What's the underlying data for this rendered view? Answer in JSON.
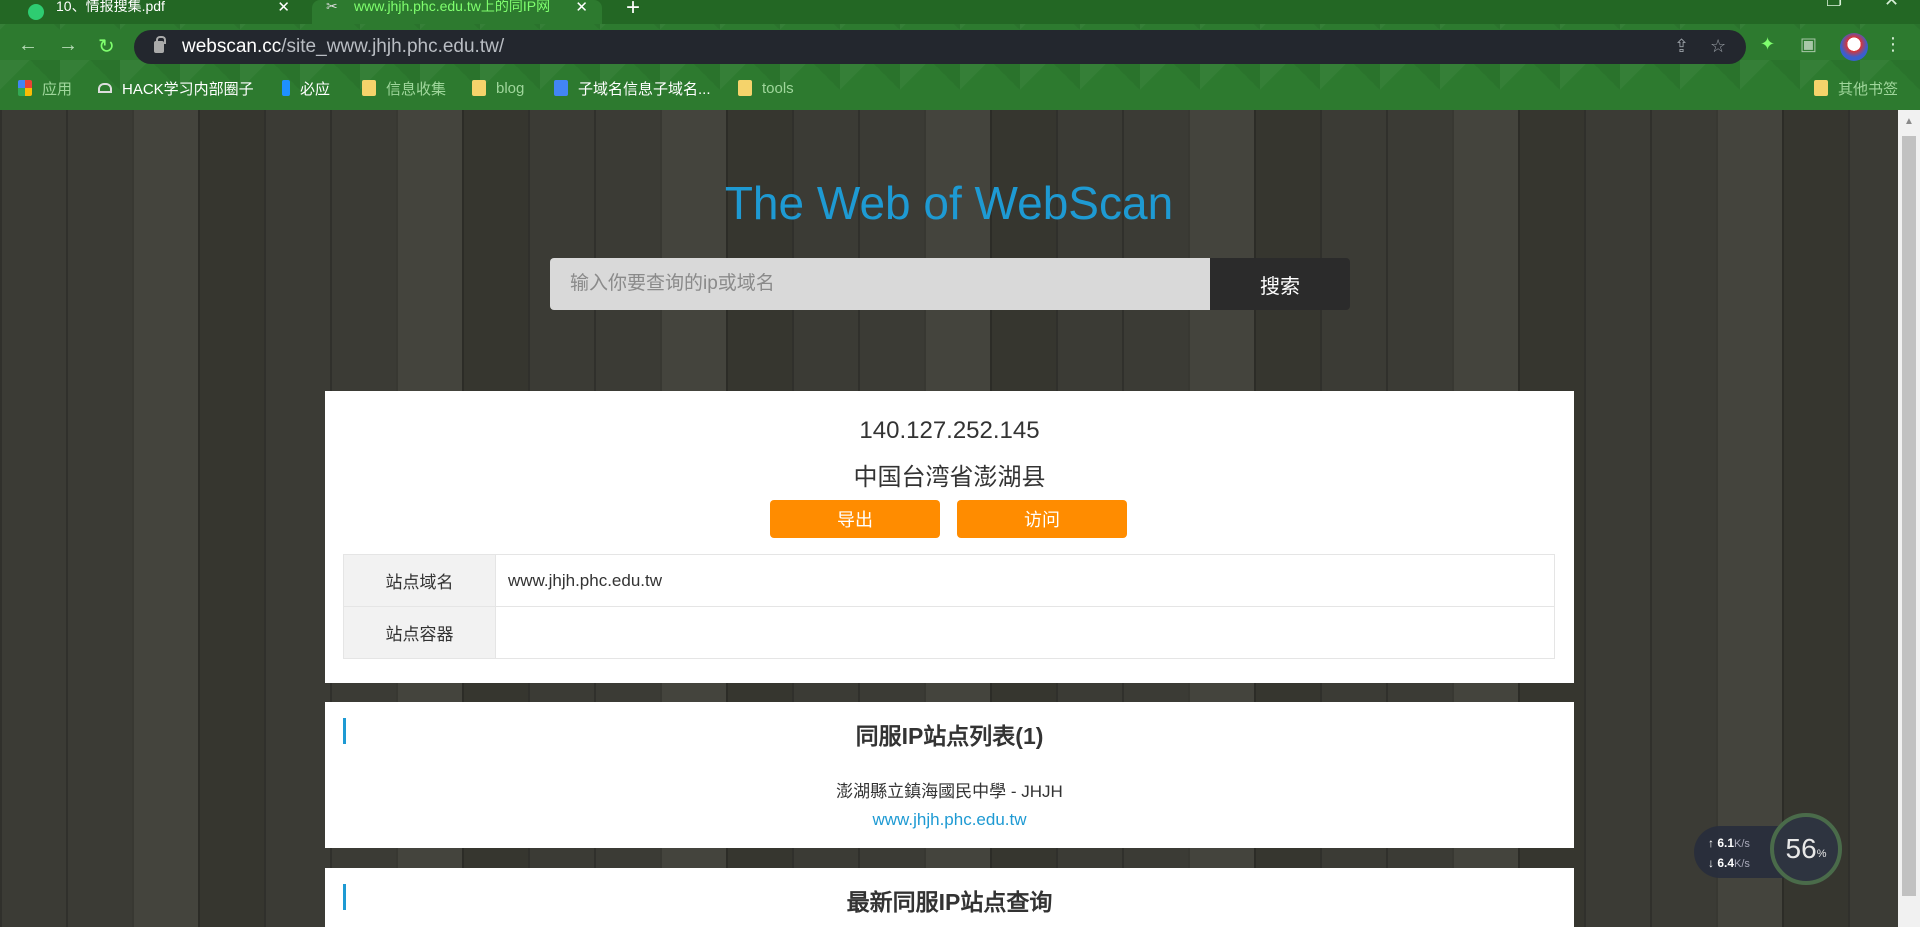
{
  "browser": {
    "tabs": [
      {
        "title": "10、情报搜集.pdf"
      },
      {
        "title": "www.jhjh.phc.edu.tw上的同IP网"
      }
    ],
    "url_host": "webscan.cc",
    "url_path": "/site_www.jhjh.phc.edu.tw/",
    "bookmarks": [
      {
        "label": "应用"
      },
      {
        "label": "HACK学习内部圈子"
      },
      {
        "label": "必应"
      },
      {
        "label": "信息收集"
      },
      {
        "label": "blog"
      },
      {
        "label": "子域名信息子域名..."
      },
      {
        "label": "tools"
      },
      {
        "label": "其他书签"
      }
    ]
  },
  "site": {
    "title": "The Web of WebScan",
    "search_placeholder": "输入你要查询的ip或域名",
    "search_button": "搜索"
  },
  "ip_card": {
    "ip": "140.127.252.145",
    "location": "中国台湾省澎湖县",
    "export_button": "导出",
    "visit_button": "访问",
    "rows": [
      {
        "key": "站点域名",
        "value": "www.jhjh.phc.edu.tw"
      },
      {
        "key": "站点容器",
        "value": ""
      }
    ]
  },
  "same_ip": {
    "heading": "同服IP站点列表(1)",
    "sites": [
      {
        "name": "澎湖縣立鎮海國民中學 - JHJH",
        "url": "www.jhjh.phc.edu.tw"
      }
    ]
  },
  "latest": {
    "heading": "最新同服IP站点查询"
  },
  "net_widget": {
    "up": "6.1",
    "down": "6.4",
    "unit": "K/s",
    "percent": "56",
    "percent_sign": "%"
  }
}
